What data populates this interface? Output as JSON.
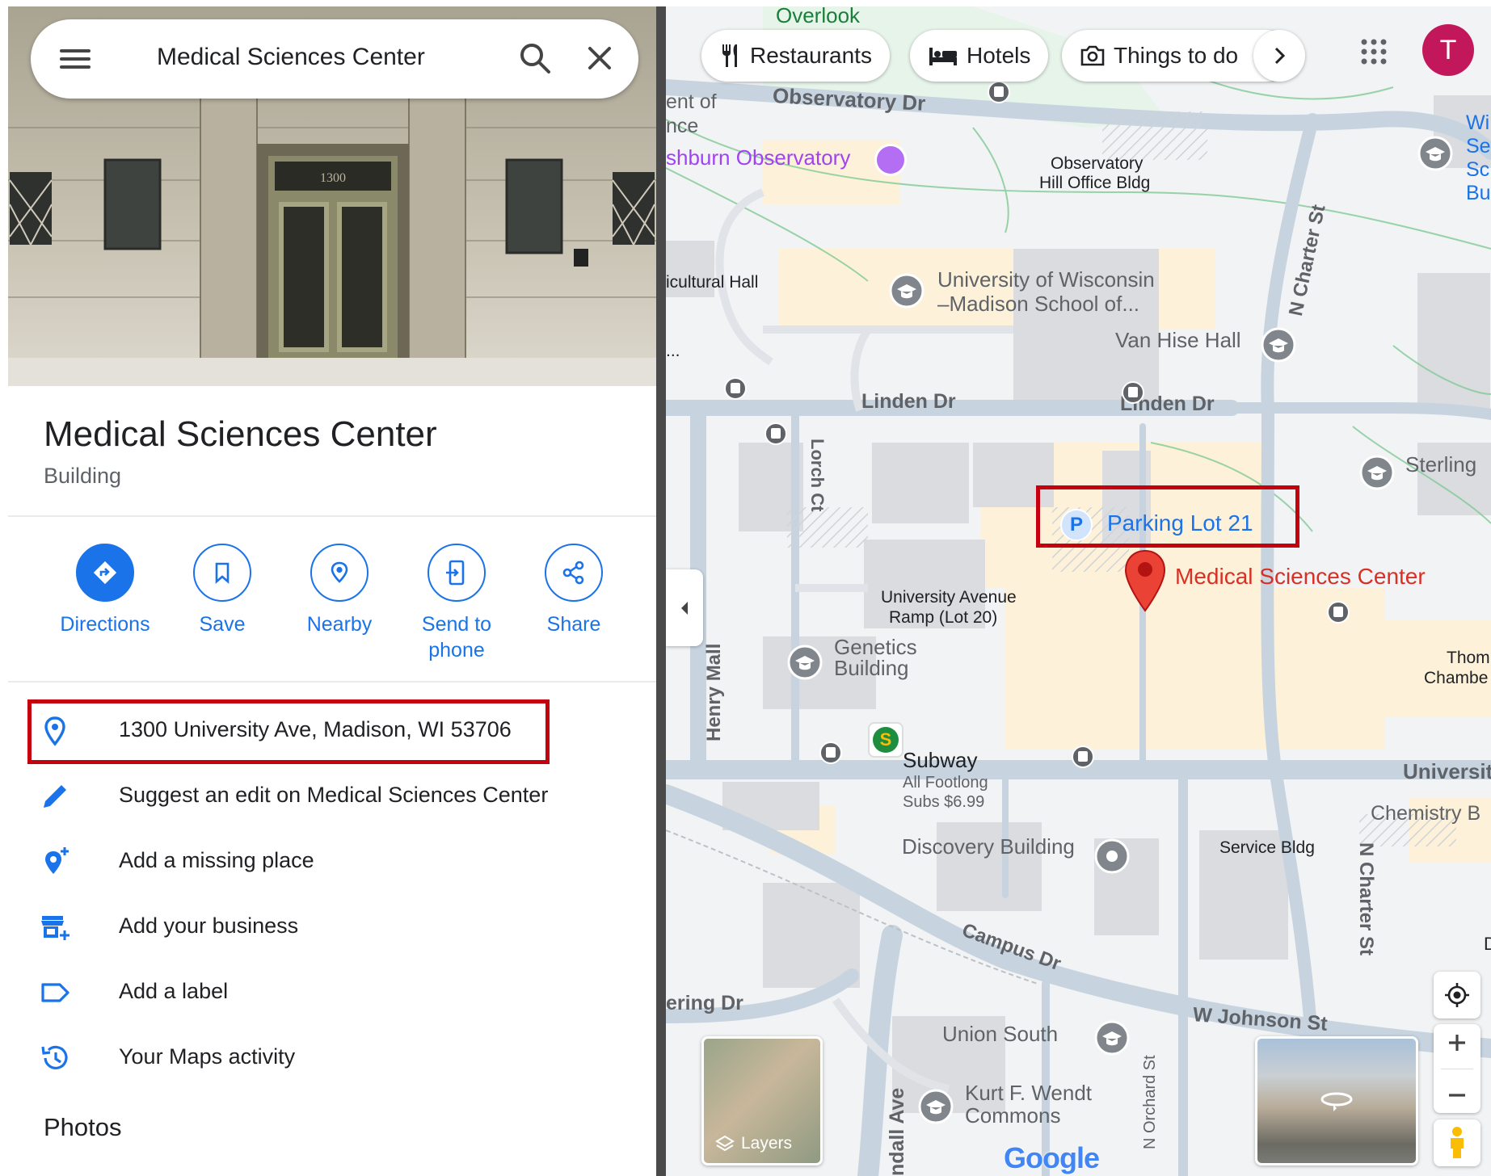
{
  "search": {
    "query": "Medical Sciences Center"
  },
  "place": {
    "title": "Medical Sciences Center",
    "type": "Building",
    "door_number": "1300"
  },
  "actions": [
    {
      "label": "Directions"
    },
    {
      "label": "Save"
    },
    {
      "label": "Nearby"
    },
    {
      "label": "Send to phone"
    },
    {
      "label": "Share"
    }
  ],
  "info_rows": [
    {
      "text": "1300 University Ave, Madison, WI 53706",
      "icon": "location-pin-icon"
    },
    {
      "text": "Suggest an edit on Medical Sciences Center",
      "icon": "pencil-icon"
    },
    {
      "text": "Add a missing place",
      "icon": "add-place-icon"
    },
    {
      "text": "Add your business",
      "icon": "storefront-add-icon"
    },
    {
      "text": "Add a label",
      "icon": "label-icon"
    },
    {
      "text": "Your Maps activity",
      "icon": "history-icon"
    }
  ],
  "photos_heading": "Photos",
  "map": {
    "chips": [
      "Restaurants",
      "Hotels",
      "Things to do"
    ],
    "account_initial": "T",
    "layers_label": "Layers",
    "google_logo": "Google",
    "streets": {
      "observatory_dr": "Observatory Dr",
      "linden_dr_1": "Linden Dr",
      "linden_dr_2": "Linden Dr",
      "n_charter_st_1": "N Charter St",
      "n_charter_st_2": "N Charter St",
      "lorch_ct": "Lorch Ct",
      "henry_mall": "Henry Mall",
      "campus_dr": "Campus Dr",
      "w_johnson_st": "W Johnson St",
      "n_orchard_st": "N Orchard St",
      "university": "Universit",
      "ering_dr": "ering Dr",
      "ndall_ave": "ndall Ave"
    },
    "places": {
      "overlook": "Overlook",
      "ent_of_nce_1": "ent of",
      "ent_of_nce_2": "nce",
      "washburn": "shburn Observatory",
      "observatory_hill_1": "Observatory",
      "observatory_hill_2": "Hill Office Bldg",
      "agricultural": "icultural Hall",
      "uw_school_1": "University of Wisconsin",
      "uw_school_2": "–Madison School of...",
      "van_hise": "Van Hise Hall",
      "sterling": "Sterling",
      "parking_lot": "Parking Lot 21",
      "medical_center": "Medical Sciences Center",
      "ramp_1": "University Avenue",
      "ramp_2": "Ramp (Lot 20)",
      "genetics_1": "Genetics",
      "genetics_2": "Building",
      "thomas_1": "Thom",
      "thomas_2": "Chambe",
      "subway": "Subway",
      "subway_sub_1": "All Footlong",
      "subway_sub_2": "Subs $6.99",
      "discovery": "Discovery Building",
      "service_bldg": "Service Bldg",
      "chemistry": "Chemistry B",
      "union_south": "Union South",
      "kurt_1": "Kurt F. Wendt",
      "kurt_2": "Commons",
      "wi_1": "Wi",
      "wi_2": "Se",
      "wi_3": "Sc",
      "wi_4": "Bu",
      "ellipsis": "...",
      "d_letter": "D"
    },
    "colors": {
      "accent": "#1a73e8",
      "marker": "#ea4335",
      "highlight": "#c5000f",
      "road": "#c7d4e0",
      "campus": "#fdf2d9"
    }
  }
}
